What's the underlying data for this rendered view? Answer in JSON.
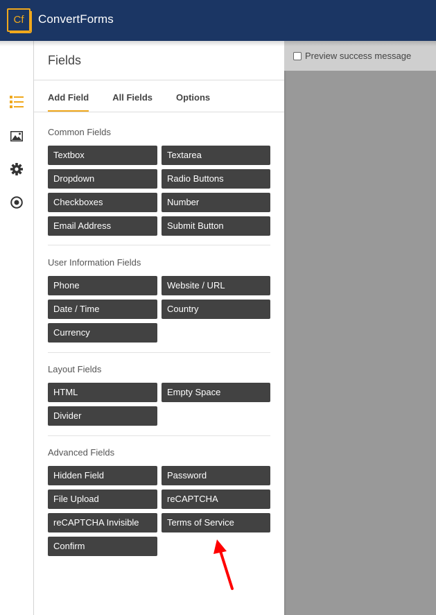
{
  "app": {
    "logo_text": "Cf",
    "brand_name": "ConvertForms",
    "accent_color": "#f0a81c",
    "header_color": "#1b3664"
  },
  "rail": {
    "items": [
      {
        "icon": "fields-list-icon",
        "active": true
      },
      {
        "icon": "image-icon",
        "active": false
      },
      {
        "icon": "gear-icon",
        "active": false
      },
      {
        "icon": "target-icon",
        "active": false
      }
    ]
  },
  "panel": {
    "title": "Fields",
    "tabs": [
      {
        "label": "Add Field",
        "active": true
      },
      {
        "label": "All Fields",
        "active": false
      },
      {
        "label": "Options",
        "active": false
      }
    ],
    "sections": [
      {
        "title": "Common Fields",
        "buttons": [
          "Textbox",
          "Textarea",
          "Dropdown",
          "Radio Buttons",
          "Checkboxes",
          "Number",
          "Email Address",
          "Submit Button"
        ]
      },
      {
        "title": "User Information Fields",
        "buttons": [
          "Phone",
          "Website / URL",
          "Date / Time",
          "Country",
          "Currency"
        ]
      },
      {
        "title": "Layout Fields",
        "buttons": [
          "HTML",
          "Empty Space",
          "Divider"
        ]
      },
      {
        "title": "Advanced Fields",
        "buttons": [
          "Hidden Field",
          "Password",
          "File Upload",
          "reCAPTCHA",
          "reCAPTCHA Invisible",
          "Terms of Service",
          "Confirm"
        ]
      }
    ]
  },
  "preview": {
    "checkbox_label": "Preview success message",
    "checked": false
  },
  "annotation": {
    "type": "red-arrow",
    "points_to": "Terms of Service",
    "color": "#ff0000"
  }
}
